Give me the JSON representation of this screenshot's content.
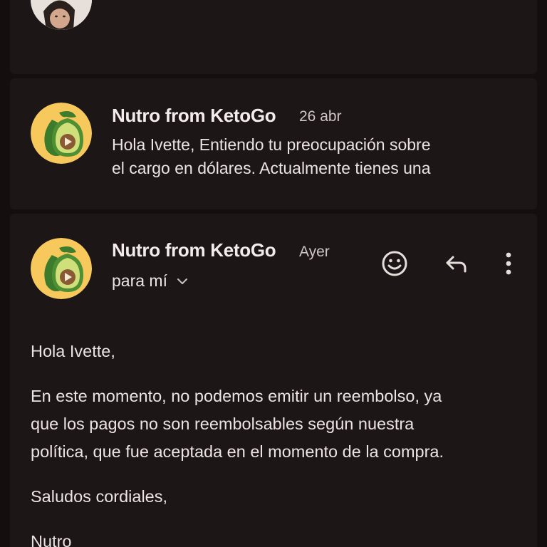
{
  "thread": {
    "messages": [
      {
        "sender": "",
        "date": "",
        "avatar": "profile-photo"
      },
      {
        "sender": "Nutro from KetoGo",
        "date": "26 abr",
        "snippet_line1": "Hola Ivette, Entiendo tu preocupación sobre",
        "snippet_line2": "el cargo en dólares. Actualmente tienes una",
        "avatar": "avocado-icon"
      },
      {
        "sender": "Nutro from KetoGo",
        "date": "Ayer",
        "recipient": "para mí",
        "avatar": "avocado-icon",
        "body": {
          "greeting": "Hola Ivette,",
          "paragraph_line1": "En este momento, no podemos emitir un reembolso, ya",
          "paragraph_line2": "que los pagos no son reembolsables según nuestra",
          "paragraph_line3": "política, que fue aceptada en el momento de la compra.",
          "closing": "Saludos cordiales,",
          "signature": "Nutro"
        }
      }
    ]
  },
  "actions": {
    "emoji": "emoji-reaction-icon",
    "reply": "reply-icon",
    "more": "more-options-icon"
  },
  "colors": {
    "background": "#140e0e",
    "card": "#1d1616",
    "text": "#ece4e2",
    "muted": "#cfc6c3",
    "avatar_bg": "#f7c85c"
  }
}
